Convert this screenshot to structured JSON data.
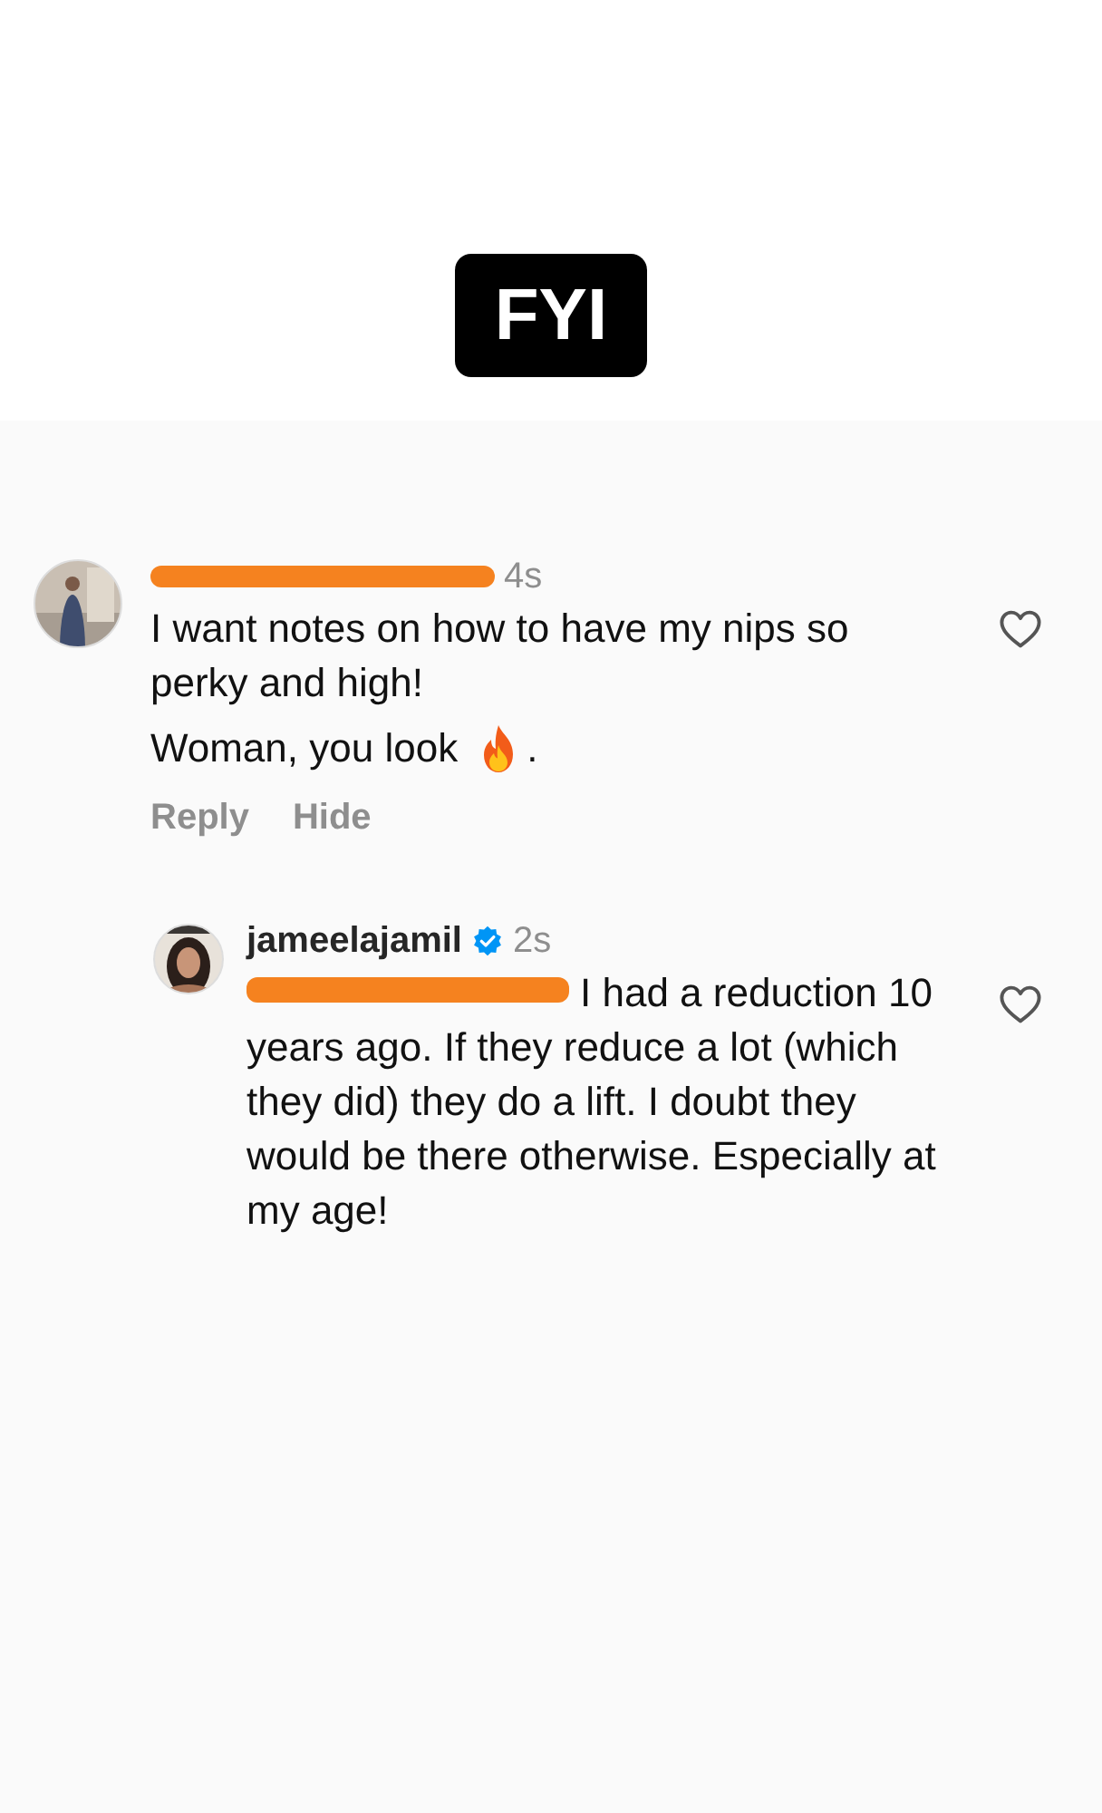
{
  "caption": {
    "text": "FYI"
  },
  "comments": [
    {
      "author_visible": false,
      "time": "4s",
      "text": "I want notes on how to have my nips so perky and high!",
      "after_emoji_before": "Woman, you look",
      "after_emoji_after": ".",
      "liked": false,
      "actions": [
        "Reply",
        "Hide"
      ],
      "reply": {
        "author": "jameelajamil",
        "verified": true,
        "time": "2s",
        "mention_hidden": true,
        "text": "I had a reduction 10 years ago. If they reduce a lot (which they did) they do a lift. I doubt they would be there otherwise. Especially at my age!",
        "liked": false
      }
    }
  ]
}
